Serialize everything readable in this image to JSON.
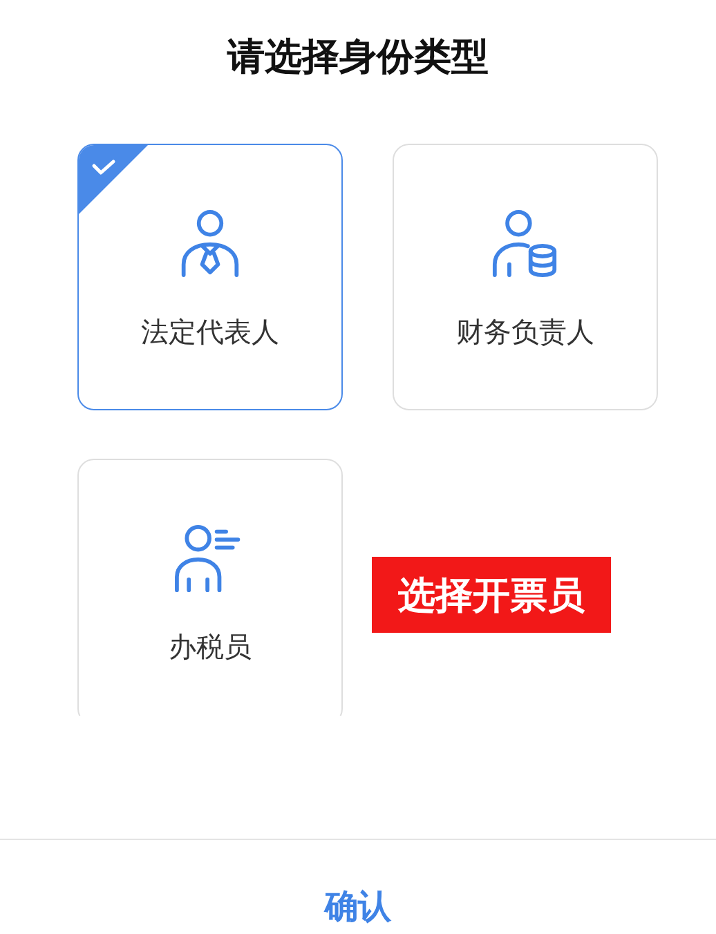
{
  "title": "请选择身份类型",
  "options": [
    {
      "label": "法定代表人",
      "kind": "tie",
      "selected": true
    },
    {
      "label": "财务负责人",
      "kind": "coins",
      "selected": false
    },
    {
      "label": "办税员",
      "kind": "lines",
      "selected": false
    }
  ],
  "annotation": "选择开票员",
  "confirm_button": "确认"
}
